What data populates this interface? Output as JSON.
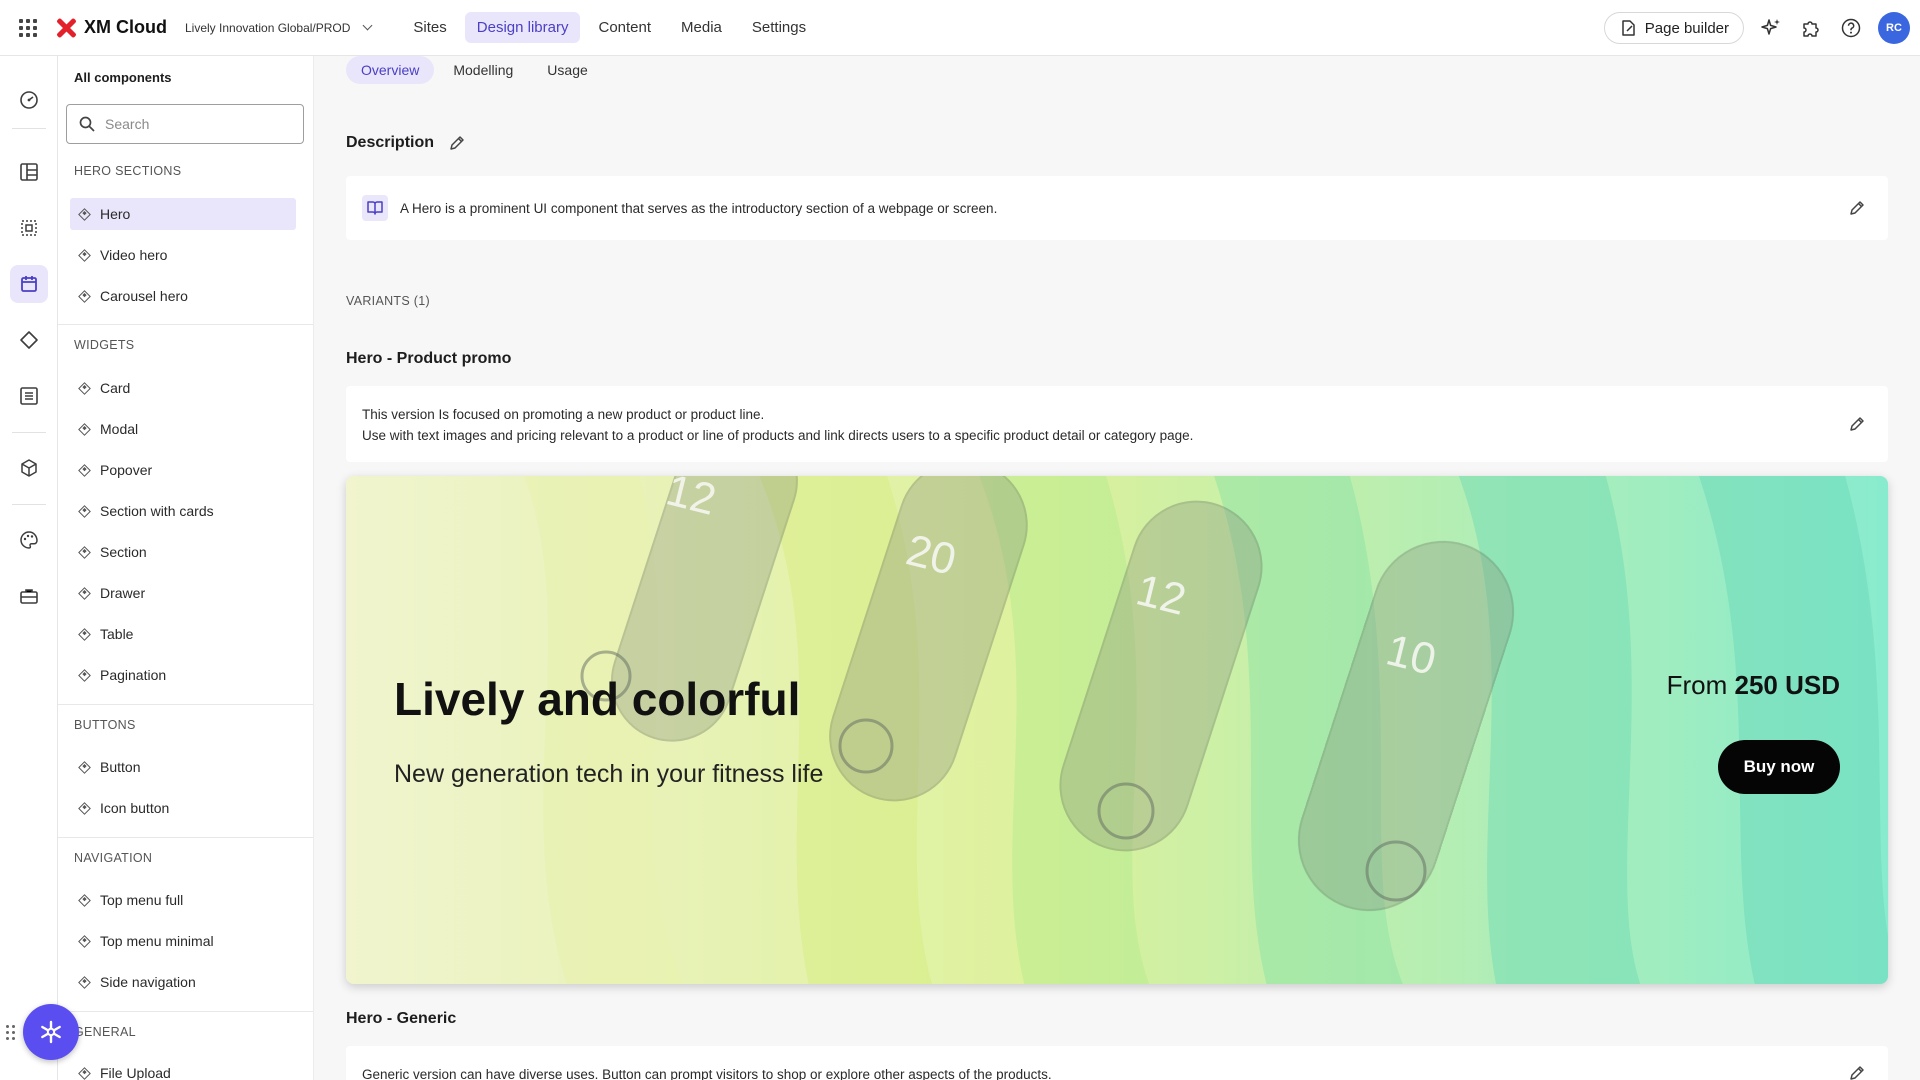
{
  "topbar": {
    "app_name": "XM Cloud",
    "org": "Lively Innovation Global/PROD",
    "nav": [
      "Sites",
      "Design library",
      "Content",
      "Media",
      "Settings"
    ],
    "active_nav": "Design library",
    "page_builder_label": "Page builder",
    "avatar_initials": "RC",
    "icons": [
      "apps-grid-icon",
      "sparkle-icon",
      "puzzle-icon",
      "help-icon"
    ]
  },
  "rail": {
    "icons": [
      "dashboard-icon",
      "layout-icon",
      "component-select-icon",
      "design-library-icon",
      "diamond-icon",
      "list-icon",
      "cube-icon",
      "palette-icon",
      "toolbox-icon"
    ],
    "active_icon": "design-library-icon"
  },
  "sidebar": {
    "title": "All components",
    "search_placeholder": "Search",
    "sections": [
      {
        "label": "HERO SECTIONS",
        "items": [
          "Hero",
          "Video hero",
          "Carousel hero"
        ]
      },
      {
        "label": "WIDGETS",
        "items": [
          "Card",
          "Modal",
          "Popover",
          "Section with cards",
          "Section",
          "Drawer",
          "Table",
          "Pagination"
        ]
      },
      {
        "label": "BUTTONS",
        "items": [
          "Button",
          "Icon button"
        ]
      },
      {
        "label": "NAVIGATION",
        "items": [
          "Top menu full",
          "Top menu minimal",
          "Side navigation"
        ]
      },
      {
        "label": "GENERAL",
        "items": [
          "File Upload"
        ]
      }
    ],
    "active_item": "Hero"
  },
  "main": {
    "tabs": [
      "Overview",
      "Modelling",
      "Usage"
    ],
    "active_tab": "Overview",
    "description_heading": "Description",
    "description_text": "A Hero is a prominent UI component that serves as the introductory section of a webpage or screen.",
    "variants_label": "VARIANTS (1)",
    "variant1": {
      "title": "Hero -  Product promo",
      "line1": "This version Is focused on promoting a new product or product line.",
      "line2": "Use with text images and pricing relevant to a product or line of products and link directs users to a specific product detail or category page."
    },
    "hero": {
      "title": "Lively and colorful",
      "subtitle": "New generation tech in your fitness life",
      "price_prefix": "From ",
      "price": "250 USD",
      "cta": "Buy now",
      "watch_digits": [
        "12",
        "20",
        "12",
        "10"
      ],
      "colors": {
        "start": "#eef2c4",
        "mid": "#d6ee86",
        "end": "#6fe7c3"
      }
    },
    "variant2": {
      "title": "Hero - Generic",
      "text": "Generic version can have diverse uses. Button can prompt visitors to shop or explore other aspects of the products."
    }
  },
  "colors": {
    "accent": "#4a3fc6",
    "accent_bg": "#e9e6fb",
    "fab": "#5b4ef0"
  }
}
